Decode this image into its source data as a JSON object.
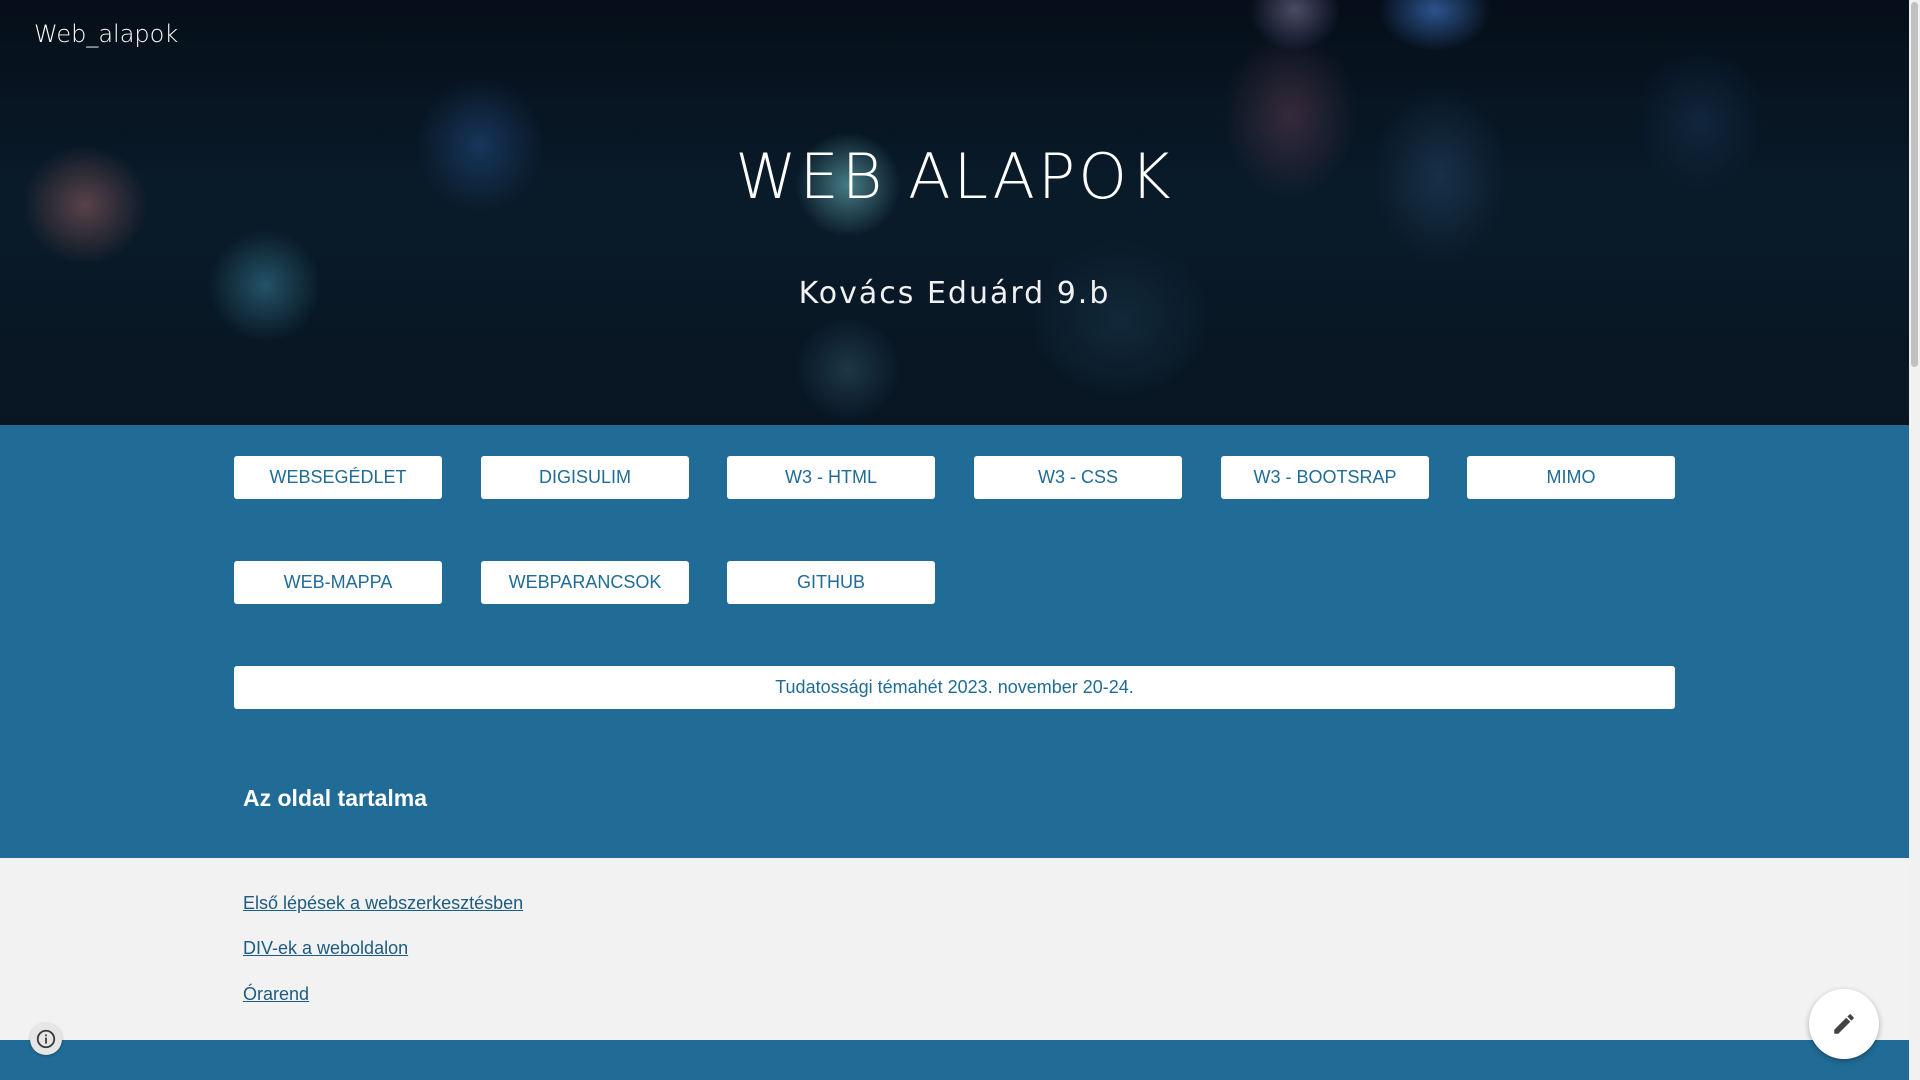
{
  "header": {
    "site_name": "Web_alapok",
    "title": "WEB ALAPOK",
    "subtitle": "Kovács Eduárd 9.b"
  },
  "buttons_row1": [
    {
      "label": "WEBSEGÉDLET"
    },
    {
      "label": "DIGISULIM"
    },
    {
      "label": "W3 - HTML"
    },
    {
      "label": "W3 - CSS"
    },
    {
      "label": "W3 - BOOTSRAP"
    },
    {
      "label": "MIMO"
    }
  ],
  "buttons_row2": [
    {
      "label": "WEB-MAPPA"
    },
    {
      "label": "WEBPARANCSOK"
    },
    {
      "label": "GITHUB"
    }
  ],
  "announcement_button": {
    "label": "Tudatossági témahét 2023. november 20-24."
  },
  "toc": {
    "heading": "Az oldal tartalma",
    "links": [
      {
        "label": "Első lépések a webszerkesztésben"
      },
      {
        "label": "DIV-ek a weboldalon"
      },
      {
        "label": "Órarend"
      }
    ]
  },
  "icons": {
    "info": "info-icon",
    "edit": "pencil-icon"
  },
  "colors": {
    "accent_blue": "#216c96",
    "button_bg": "#ffffff",
    "light_bg": "#f2f2f2",
    "link": "#1d5b80"
  }
}
